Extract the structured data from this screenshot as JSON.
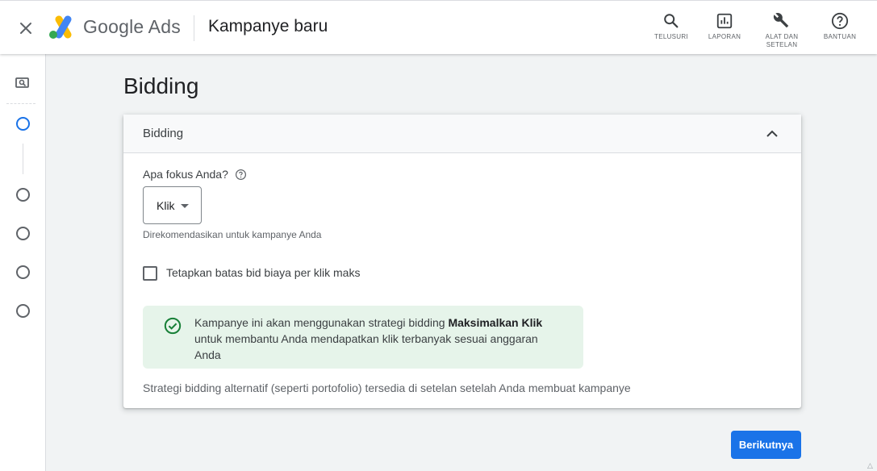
{
  "header": {
    "brand": "Google Ads",
    "page_name": "Kampanye baru",
    "tools": [
      {
        "icon": "search-icon",
        "label_lines": [
          "TELUSURI"
        ]
      },
      {
        "icon": "report-icon",
        "label_lines": [
          "LAPORAN"
        ]
      },
      {
        "icon": "wrench-icon",
        "label_lines": [
          "ALAT DAN",
          "SETELAN"
        ]
      },
      {
        "icon": "help-icon",
        "label_lines": [
          "BANTUAN"
        ]
      }
    ]
  },
  "sidebar": {
    "steps": [
      {
        "state": "active"
      },
      {
        "state": "pending"
      },
      {
        "state": "pending"
      },
      {
        "state": "pending"
      },
      {
        "state": "pending"
      }
    ]
  },
  "main": {
    "title": "Bidding",
    "card": {
      "header": "Bidding",
      "question": "Apa fokus Anda?",
      "select_value": "Klik",
      "hint": "Direkomendasikan untuk kampanye Anda",
      "checkbox_label": "Tetapkan batas bid biaya per klik maks",
      "checkbox_checked": false,
      "info": {
        "before": "Kampanye ini akan menggunakan strategi bidding ",
        "bold": "Maksimalkan Klik",
        "after": " untuk membantu Anda mendapatkan klik terbanyak sesuai anggaran Anda"
      },
      "footer": "Strategi bidding alternatif (seperti portofolio) tersedia di setelan setelah Anda membuat kampanye"
    },
    "next_button": "Berikutnya"
  },
  "colors": {
    "accent": "#1a73e8",
    "success_bg": "#e6f4ea",
    "success_icon": "#188038"
  }
}
